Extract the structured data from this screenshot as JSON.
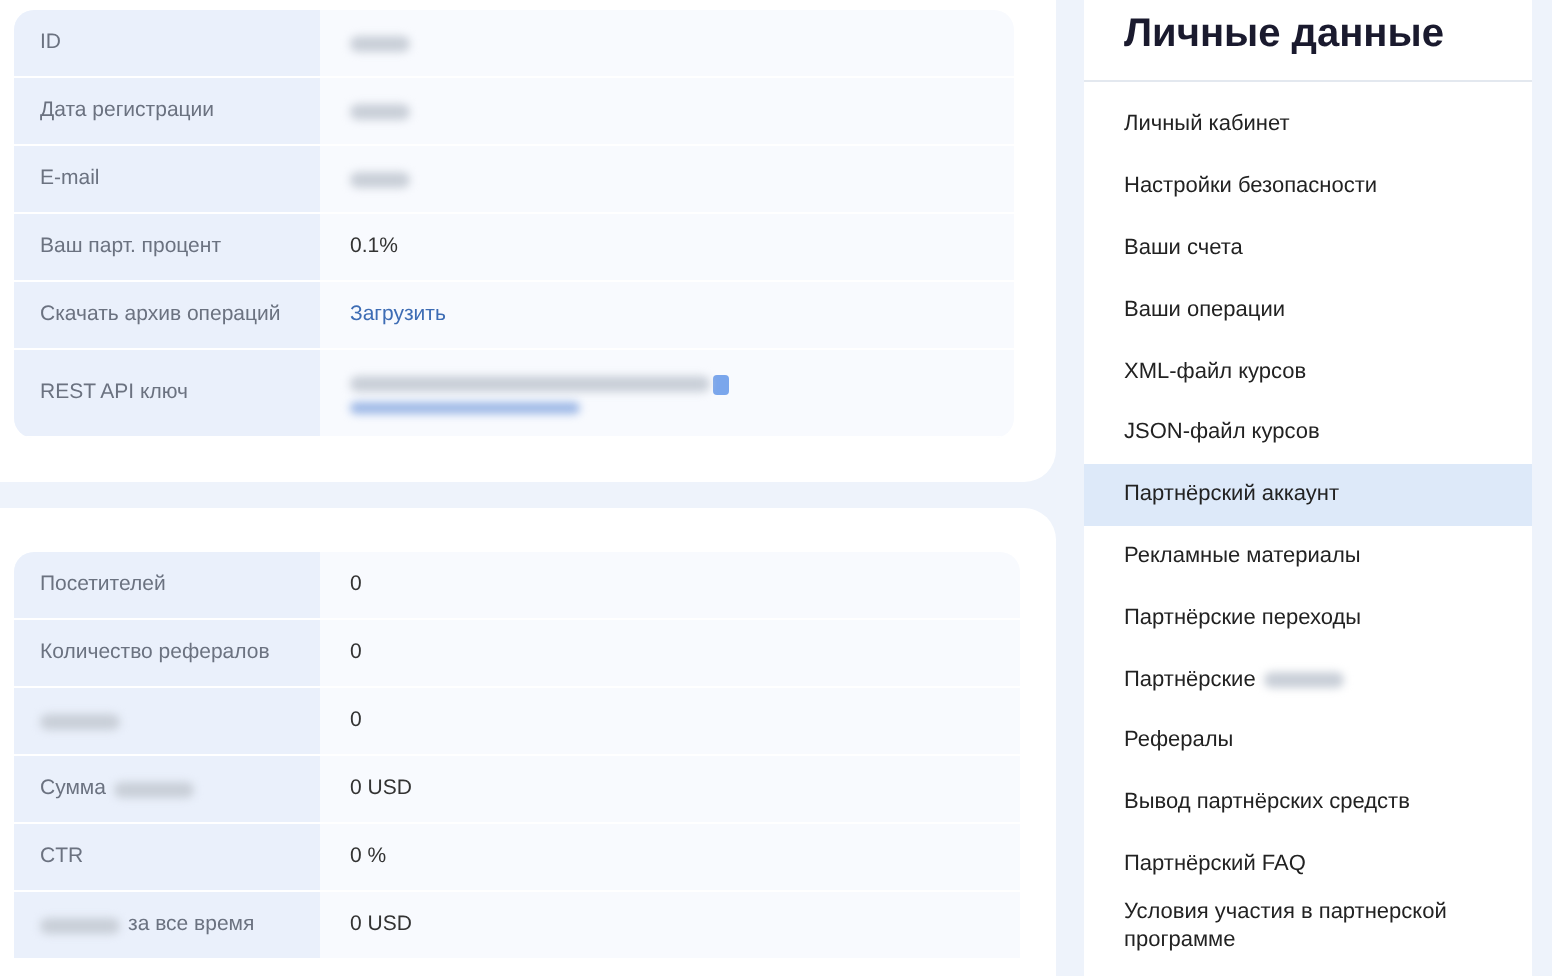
{
  "account_table": [
    {
      "label": [
        {
          "kind": "text",
          "text": "ID"
        }
      ],
      "value": {
        "kind": "redacted"
      }
    },
    {
      "label": [
        {
          "kind": "text",
          "text": "Дата регистрации"
        }
      ],
      "value": {
        "kind": "redacted"
      }
    },
    {
      "label": [
        {
          "kind": "text",
          "text": "E-mail"
        }
      ],
      "value": {
        "kind": "redacted"
      }
    },
    {
      "label": [
        {
          "kind": "text",
          "text": "Ваш парт. процент"
        }
      ],
      "value": {
        "kind": "text",
        "text": "0.1%"
      }
    },
    {
      "label": [
        {
          "kind": "text",
          "text": "Скачать архив операций"
        }
      ],
      "value": {
        "kind": "link",
        "text": "Загрузить"
      }
    },
    {
      "label": [
        {
          "kind": "text",
          "text": "REST API ключ"
        }
      ],
      "value": {
        "kind": "key"
      }
    }
  ],
  "stats_table": [
    {
      "label": [
        {
          "kind": "text",
          "text": "Посетителей"
        }
      ],
      "value": {
        "kind": "text",
        "text": "0"
      }
    },
    {
      "label": [
        {
          "kind": "text",
          "text": "Количество рефералов"
        }
      ],
      "value": {
        "kind": "text",
        "text": "0"
      }
    },
    {
      "label": [
        {
          "kind": "redacted"
        }
      ],
      "value": {
        "kind": "text",
        "text": "0"
      }
    },
    {
      "label": [
        {
          "kind": "text",
          "text": "Сумма"
        },
        {
          "kind": "redacted"
        }
      ],
      "value": {
        "kind": "text",
        "text": "0 USD"
      }
    },
    {
      "label": [
        {
          "kind": "text",
          "text": "CTR"
        }
      ],
      "value": {
        "kind": "text",
        "text": "0 %"
      }
    },
    {
      "label": [
        {
          "kind": "redacted"
        },
        {
          "kind": "text",
          "text": "за все время"
        }
      ],
      "value": {
        "kind": "text",
        "text": "0 USD"
      }
    }
  ],
  "sidebar": {
    "title": "Личные данные",
    "items": [
      {
        "parts": [
          {
            "kind": "text",
            "text": "Личный кабинет"
          }
        ],
        "selected": false
      },
      {
        "parts": [
          {
            "kind": "text",
            "text": "Настройки безопасности"
          }
        ],
        "selected": false
      },
      {
        "parts": [
          {
            "kind": "text",
            "text": "Ваши счета"
          }
        ],
        "selected": false
      },
      {
        "parts": [
          {
            "kind": "text",
            "text": "Ваши операции"
          }
        ],
        "selected": false
      },
      {
        "parts": [
          {
            "kind": "text",
            "text": "XML-файл курсов"
          }
        ],
        "selected": false
      },
      {
        "parts": [
          {
            "kind": "text",
            "text": "JSON-файл курсов"
          }
        ],
        "selected": false
      },
      {
        "parts": [
          {
            "kind": "text",
            "text": "Партнёрский аккаунт"
          }
        ],
        "selected": true
      },
      {
        "parts": [
          {
            "kind": "text",
            "text": "Рекламные материалы"
          }
        ],
        "selected": false
      },
      {
        "parts": [
          {
            "kind": "text",
            "text": "Партнёрские переходы"
          }
        ],
        "selected": false
      },
      {
        "parts": [
          {
            "kind": "text",
            "text": "Партнёрские"
          },
          {
            "kind": "redacted"
          }
        ],
        "selected": false
      },
      {
        "parts": [
          {
            "kind": "text",
            "text": "Рефералы"
          }
        ],
        "selected": false
      },
      {
        "parts": [
          {
            "kind": "text",
            "text": "Вывод партнёрских средств"
          }
        ],
        "selected": false
      },
      {
        "parts": [
          {
            "kind": "text",
            "text": "Партнёрский FAQ"
          }
        ],
        "selected": false
      },
      {
        "parts": [
          {
            "kind": "text",
            "text": "Условия участия в партнерской программе"
          }
        ],
        "selected": false
      }
    ]
  }
}
